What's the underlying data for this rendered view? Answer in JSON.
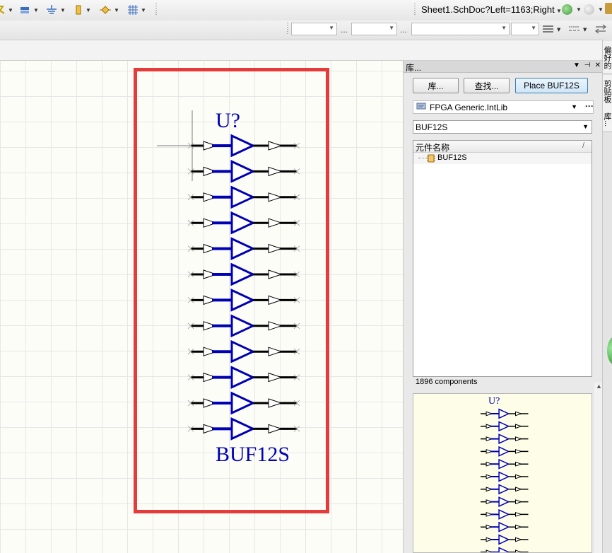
{
  "toolbar": {
    "address": "Sheet1.SchDoc?Left=1163;Right",
    "icons": [
      "bus-entry-icon",
      "port-icon",
      "ground-icon",
      "power-port-icon",
      "junction-icon",
      "grid-icon"
    ],
    "back_icon": "back-arrow-icon",
    "forward_icon": "forward-arrow-icon"
  },
  "schematic": {
    "designator": "U?",
    "part_name": "BUF12S",
    "buffer_count": 12,
    "colors": {
      "body": "#0000b4",
      "pin": "#000000",
      "frame": "#e53b3b"
    }
  },
  "panel": {
    "title": "库...",
    "buttons": {
      "libraries": "库...",
      "search": "查找...",
      "place": "Place BUF12S"
    },
    "library": {
      "name": "FPGA Generic.IntLib",
      "more": "···"
    },
    "filter": {
      "value": "BUF12S"
    },
    "list": {
      "column": "元件名称",
      "sort_indicator": "/",
      "items": [
        {
          "name": "BUF12S"
        }
      ]
    },
    "count": "1896 components",
    "preview": {
      "designator": "U?"
    }
  },
  "sidebar": {
    "tabs": [
      "偏好的",
      "剪贴板",
      "库..."
    ]
  }
}
